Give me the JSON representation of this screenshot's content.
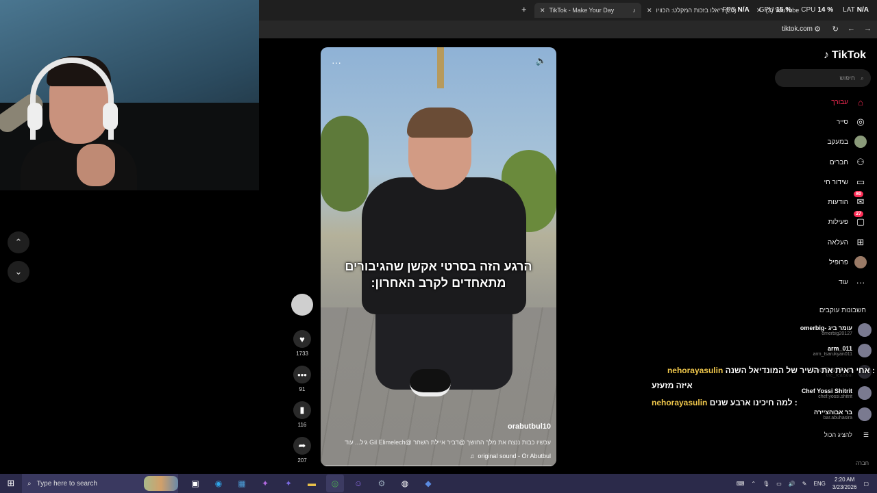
{
  "browser": {
    "tabs": [
      {
        "label": "TikTok - Make Your Day",
        "close": "✕"
      },
      {
        "label": "(20) ריאלו בזכות המקלט: הכוויו",
        "close": "✕"
      },
      {
        "label": "(3) YouTube",
        "close": "✕"
      }
    ],
    "new_tab": "+",
    "url": "tiktok.com"
  },
  "perf": {
    "fps_label": "FPS",
    "fps": "N/A",
    "gpu_label": "GPU",
    "gpu": "15 %",
    "cpu_label": "CPU",
    "cpu": "14 %",
    "lat_label": "LAT",
    "lat": "N/A"
  },
  "video": {
    "caption_line1": "הרגע הזה בסרטי אקשן שהגיבורים",
    "caption_line2": "מתאחדים לקרב האחרון:",
    "author": "orabutbul10",
    "description": "עכשיו כבות ננצח את מלך החושך @דביר איילת השחר @Gil Elimelech גיל...",
    "more": "עוד",
    "sound": "original sound - Or Abutbul",
    "sound_icon": "♫"
  },
  "actions": {
    "likes": "1733",
    "comments": "91",
    "saves": "116",
    "shares": "207"
  },
  "sidebar": {
    "logo": "TikTok",
    "search_placeholder": "חיפוש",
    "items": [
      {
        "label": "עבורך"
      },
      {
        "label": "סייר"
      },
      {
        "label": "במעקב"
      },
      {
        "label": "חברים"
      },
      {
        "label": "שידור חי"
      },
      {
        "label": "הודעות",
        "badge": "80"
      },
      {
        "label": "פעילות",
        "badge": "27"
      },
      {
        "label": "העלאה"
      },
      {
        "label": "פרופיל"
      },
      {
        "label": "עוד"
      }
    ],
    "following_title": "חשבונות עוקבים",
    "accounts": [
      {
        "name": "omerbig- עומר ביג",
        "handle": "omerbig20127"
      },
      {
        "name": "arm_011",
        "handle": "arm_tsarukyan011"
      },
      {
        "name": "The Real Soul",
        "handle": "the_realsoul"
      },
      {
        "name": "Chef Yossi Shitrit",
        "handle": "chef.yossi.shitrit"
      },
      {
        "name": "בר אבוהציירה",
        "handle": "bar.abuhasira"
      }
    ],
    "show_all": "להציג הכול",
    "footer": "חברה"
  },
  "chat": [
    {
      "user": "nehorayasulin",
      "text": ": אחי ראית את השיר של המונדיאל השנה"
    },
    {
      "user": "",
      "text": "איזה מזעזע"
    },
    {
      "user": "nehorayasulin",
      "text": ": למה חיכינו ארבע שנים"
    }
  ],
  "taskbar": {
    "search_placeholder": "Type here to search",
    "lang": "ENG",
    "time": "2:20 AM",
    "date": "3/23/2026"
  },
  "colors": {
    "accent": "#fe2c55",
    "chat_user": "#f2c94c",
    "taskbar": "#2b2a4a"
  }
}
